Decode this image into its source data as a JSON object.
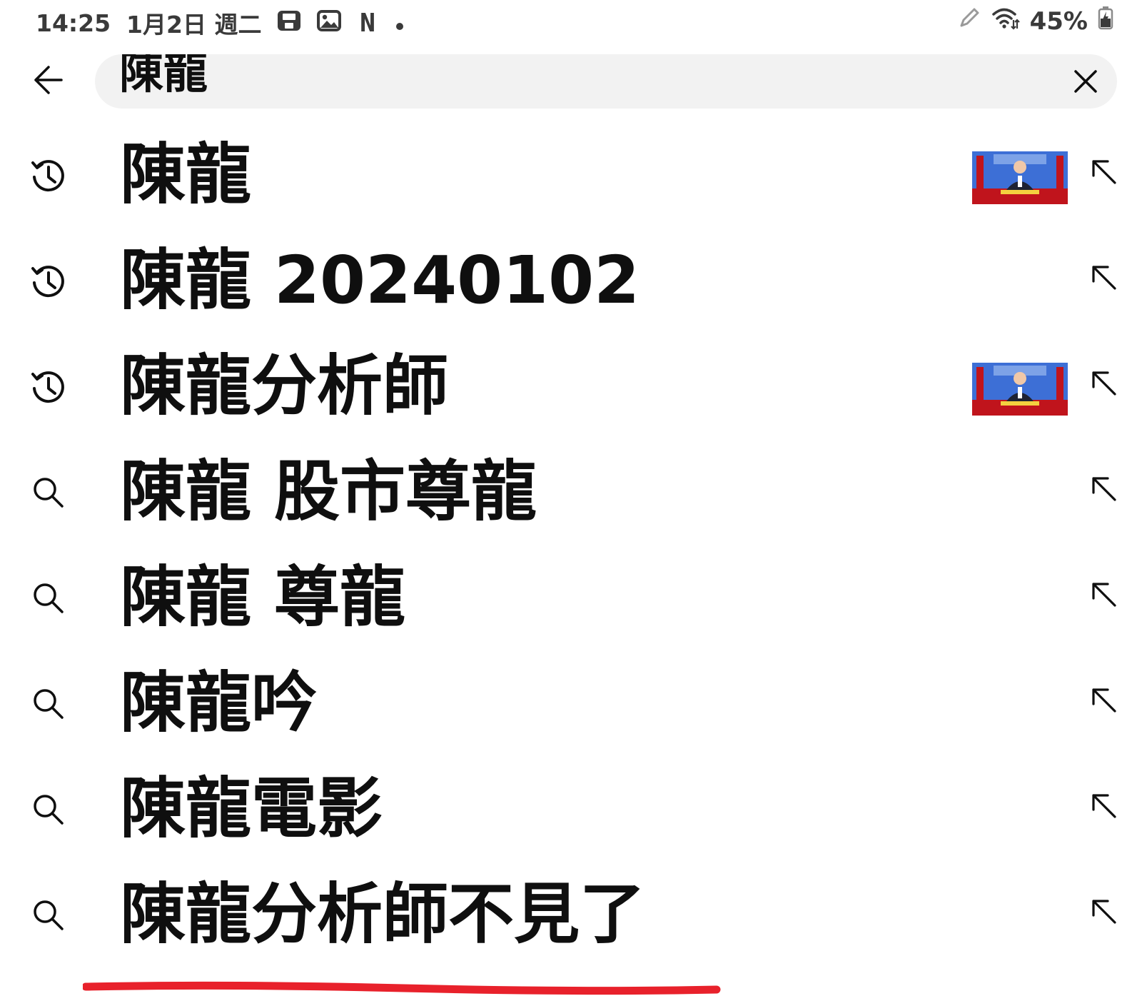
{
  "status_bar": {
    "time": "14:25",
    "date": "1月2日 週二",
    "notification_icons": [
      "save-icon",
      "image-icon",
      "netflix-n-icon",
      "dot-icon"
    ],
    "netflix_letter": "N",
    "battery": "45%",
    "right_icons": [
      "pen-icon",
      "wifi-icon",
      "battery-icon"
    ]
  },
  "search": {
    "query": "陳龍",
    "back_icon": "arrow-left-icon",
    "clear_icon": "close-icon"
  },
  "suggestions": [
    {
      "text": "陳龍",
      "type": "history",
      "icon": "history-icon",
      "has_thumbnail": true
    },
    {
      "text": "陳龍 20240102",
      "type": "history",
      "icon": "history-icon",
      "has_thumbnail": false
    },
    {
      "text": "陳龍分析師",
      "type": "history",
      "icon": "history-icon",
      "has_thumbnail": true
    },
    {
      "text": "陳龍 股市尊龍",
      "type": "search",
      "icon": "search-icon",
      "has_thumbnail": false
    },
    {
      "text": "陳龍 尊龍",
      "type": "search",
      "icon": "search-icon",
      "has_thumbnail": false
    },
    {
      "text": "陳龍吟",
      "type": "search",
      "icon": "search-icon",
      "has_thumbnail": false
    },
    {
      "text": "陳龍電影",
      "type": "search",
      "icon": "search-icon",
      "has_thumbnail": false
    },
    {
      "text": "陳龍分析師不見了",
      "type": "search",
      "icon": "search-icon",
      "has_thumbnail": false
    }
  ],
  "fill_icon": "arrow-up-left-icon",
  "colors": {
    "annotation_underline": "#e8212b",
    "search_bg": "#f2f2f2",
    "text": "#0f0f0f",
    "status_text": "#3a3a3a",
    "thumbnail_blue": "#3d6fd6",
    "thumbnail_red": "#c0141c"
  }
}
